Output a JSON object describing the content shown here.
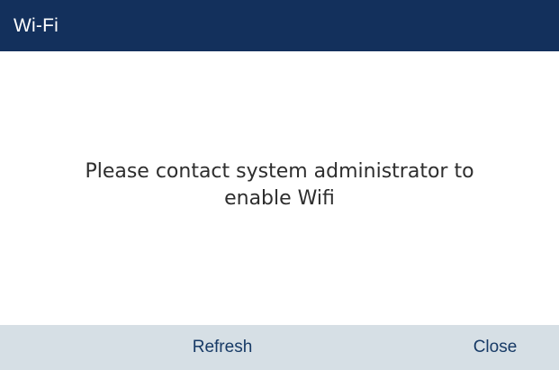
{
  "header": {
    "title": "Wi-Fi"
  },
  "main": {
    "message_line1": "Please contact system administrator to",
    "message_line2": "enable Wifi"
  },
  "softkeys": {
    "refresh_label": "Refresh",
    "close_label": "Close"
  },
  "colors": {
    "title_bar": "#13305c",
    "softkey_bar": "#d6dfe5",
    "softkey_text": "#173a66",
    "message_text": "#2e2e2e"
  }
}
